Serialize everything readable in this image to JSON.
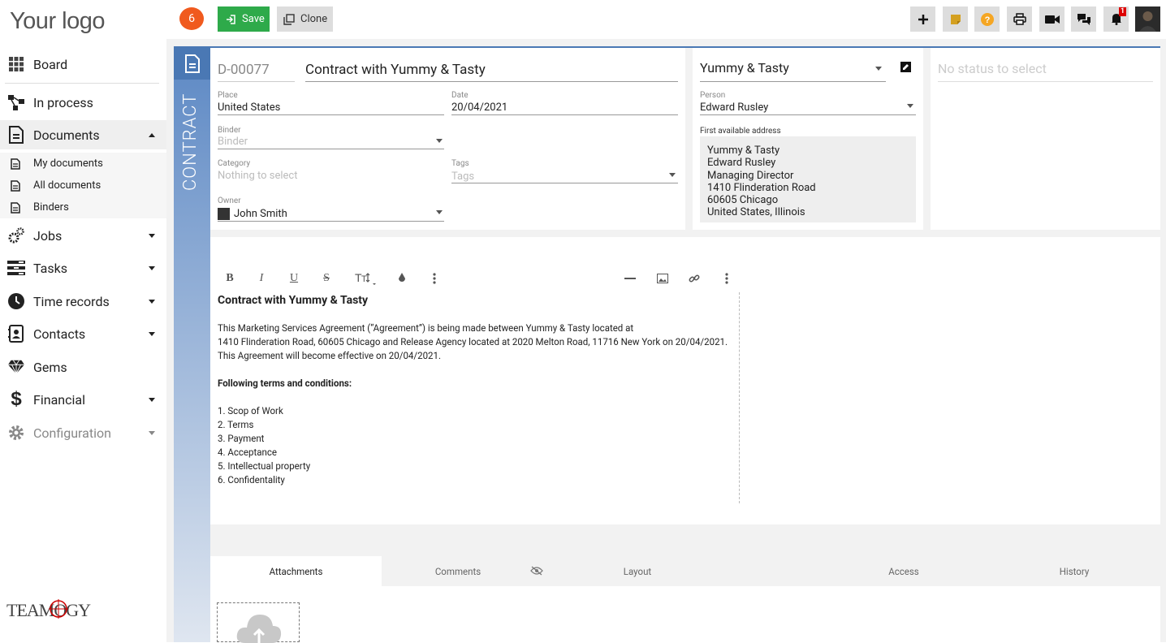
{
  "sidebar": {
    "logo": "Your logo",
    "items": [
      {
        "label": "Board"
      },
      {
        "label": "In process"
      },
      {
        "label": "Documents"
      },
      {
        "label": "Jobs"
      },
      {
        "label": "Tasks"
      },
      {
        "label": "Time records"
      },
      {
        "label": "Contacts"
      },
      {
        "label": "Gems"
      },
      {
        "label": "Financial"
      },
      {
        "label": "Configuration"
      }
    ],
    "sub_items": [
      {
        "label": "My documents"
      },
      {
        "label": "All documents"
      },
      {
        "label": "Binders"
      }
    ],
    "brand": "TEAMOGY"
  },
  "topbar": {
    "counter": "6",
    "save_label": "Save",
    "clone_label": "Clone",
    "notification_count": "1",
    "accent_colors": {
      "save": "#2eaa4a",
      "counter": "#f05a1e",
      "note": "#d4a020",
      "help": "#f5a623"
    }
  },
  "document": {
    "id": "D-00077",
    "title": "Contract with Yummy & Tasty",
    "type_label": "CONTRACT",
    "place_label": "Place",
    "place": "United States",
    "date_label": "Date",
    "date": "20/04/2021",
    "binder_label": "Binder",
    "binder_placeholder": "Binder",
    "category_label": "Category",
    "category_placeholder": "Nothing to select",
    "tags_label": "Tags",
    "tags_placeholder": "Tags",
    "owner_label": "Owner",
    "owner": "John Smith"
  },
  "contact": {
    "company": "Yummy & Tasty",
    "person_label": "Person",
    "person": "Edward Rusley",
    "address_label": "First available address",
    "address_lines": [
      "Yummy & Tasty",
      "Edward Rusley",
      "Managing Director",
      "1410 Flinderation Road",
      "60605 Chicago",
      "United States, Illinois"
    ]
  },
  "status": {
    "placeholder": "No status to select"
  },
  "editor": {
    "heading": "Contract with Yummy & Tasty",
    "paragraph_lines": [
      "This Marketing Services Agreement (“Agreement”) is being made between Yummy & Tasty located at",
      "1410 Flinderation Road, 60605 Chicago and Release Agency located at 2020 Melton Road,  11716 New York on 20/04/2021.",
      "This Agreement will become effective on 20/04/2021."
    ],
    "terms_heading": "Following terms and conditions:",
    "terms": [
      "1. Scop of Work",
      "2. Terms",
      "3. Payment",
      "4. Acceptance",
      "5. Intellectual property",
      "6. Confidentality"
    ]
  },
  "tabs": [
    {
      "label": "Attachments"
    },
    {
      "label": "Comments"
    },
    {
      "label": "Layout"
    },
    {
      "label": "Access"
    },
    {
      "label": "History"
    }
  ]
}
